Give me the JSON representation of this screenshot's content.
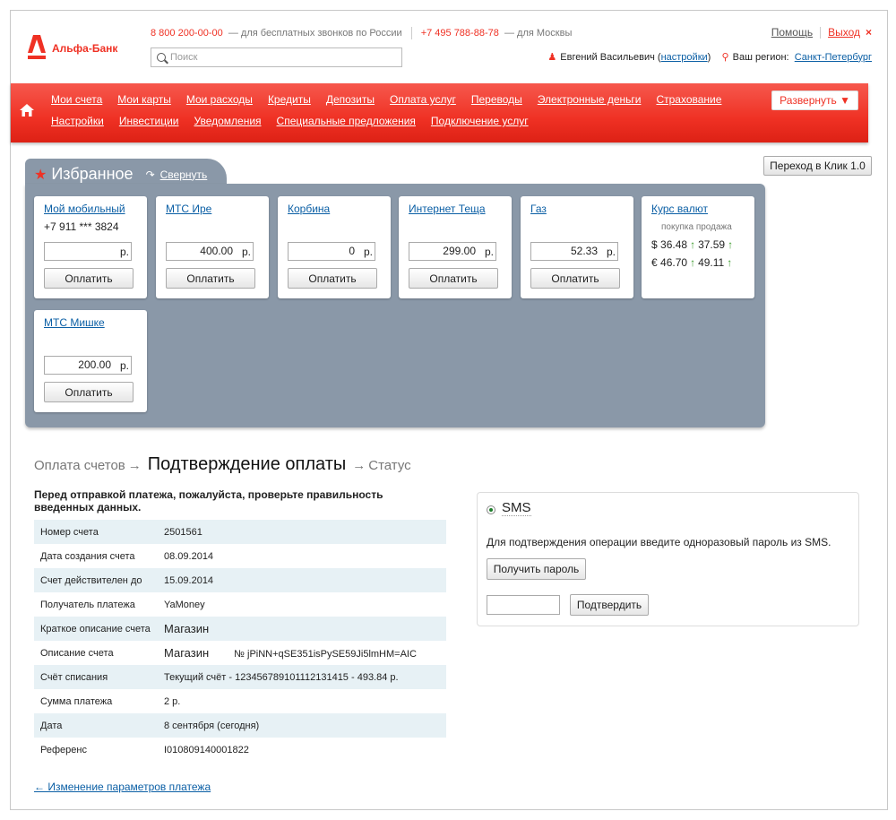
{
  "brand": {
    "name": "Альфа-Банк",
    "color": "#ef3124"
  },
  "header": {
    "phone_free": "8 800 200-00-00",
    "phone_free_note": "— для бесплатных звонков по России",
    "phone_moscow": "+7 495 788-88-78",
    "phone_moscow_note": "— для Москвы",
    "search_placeholder": "Поиск",
    "help": "Помощь",
    "exit": "Выход",
    "user_name": "Евгений Васильевич",
    "settings_link": "настройки",
    "region_label": "Ваш регион:",
    "region_value": "Санкт-Петербург"
  },
  "nav": {
    "row1": [
      "Мои счета",
      "Мои карты",
      "Мои расходы",
      "Кредиты",
      "Депозиты",
      "Оплата услуг",
      "Переводы",
      "Электронные деньги",
      "Страхование"
    ],
    "row2": [
      "Настройки",
      "Инвестиции",
      "Уведомления",
      "Специальные предложения",
      "Подключение услуг"
    ],
    "expand": "Развернуть ▼"
  },
  "klik_button": "Переход в Клик 1.0",
  "favorites": {
    "title": "Избранное",
    "collapse": "Свернуть",
    "pay_label": "Оплатить",
    "currency": "р.",
    "cards": [
      {
        "title": "Мой мобильный",
        "phone": "+7 911 *** 3824",
        "amount": ""
      },
      {
        "title": "МТС Ире",
        "amount": "400.00"
      },
      {
        "title": "Корбина",
        "amount": "0"
      },
      {
        "title": "Интернет Теща",
        "amount": "299.00"
      },
      {
        "title": "Газ",
        "amount": "52.33"
      },
      {
        "title": "МТС Мишке",
        "amount": "200.00"
      }
    ],
    "rates": {
      "title": "Курс валют",
      "buy": "покупка",
      "sell": "продажа",
      "usd": {
        "sym": "$",
        "buy": "36.48",
        "sell": "37.59"
      },
      "eur": {
        "sym": "€",
        "buy": "46.70",
        "sell": "49.11"
      },
      "up_arrow": "↑"
    }
  },
  "steps": {
    "s1": "Оплата счетов",
    "s2": "Подтверждение оплаты",
    "s3": "Статус",
    "arrow": "→"
  },
  "note": "Перед отправкой платежа, пожалуйста, проверьте правильность введенных данных.",
  "details": [
    {
      "k": "Номер счета",
      "v": "2501561"
    },
    {
      "k": "Дата создания счета",
      "v": "08.09.2014"
    },
    {
      "k": "Счет действителен до",
      "v": "15.09.2014"
    },
    {
      "k": "Получатель платежа",
      "v": "YaMoney"
    },
    {
      "k": "Краткое описание счета",
      "v": "Магазин"
    },
    {
      "k": "Описание счета",
      "v": "Магазин",
      "extra": "№ jPiNN+qSE351isPySE59Ji5lmHM=AIC"
    },
    {
      "k": "Счёт списания",
      "v": "Текущий счёт - 12345678910111213141​5 - 493.84 р."
    },
    {
      "k": "Сумма платежа",
      "v": "2 р."
    },
    {
      "k": "Дата",
      "v": "8 сентября (сегодня)"
    },
    {
      "k": "Референс",
      "v": "I010809140001822"
    }
  ],
  "back_link": "← Изменение параметров платежа",
  "sms": {
    "label": "SMS",
    "text": "Для подтверждения операции введите одноразовый пароль из SMS.",
    "get_password": "Получить пароль",
    "confirm": "Подтвердить"
  }
}
